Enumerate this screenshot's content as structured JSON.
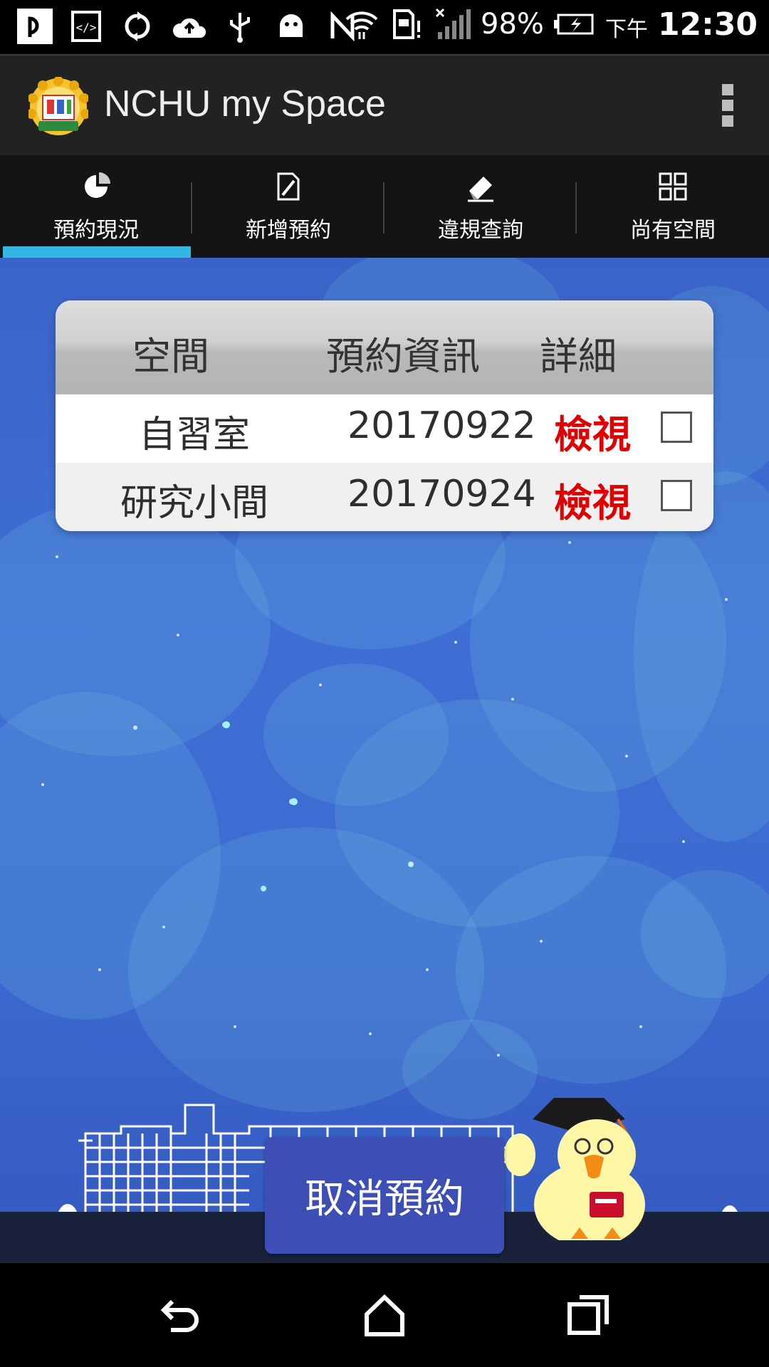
{
  "status_bar": {
    "battery_percent": "98%",
    "time_prefix": "下午",
    "time": "12:30",
    "icons": [
      "app-p-icon",
      "code-icon",
      "sync-icon",
      "cloud-upload-icon",
      "usb-icon",
      "android-icon",
      "nfc-icon",
      "wifi-icon",
      "sim-alert-icon",
      "signal-icon",
      "battery-charging-icon"
    ]
  },
  "app_bar": {
    "title": "NCHU my Space",
    "logo_text": "NCHU Library"
  },
  "tabs": [
    {
      "label": "預約現況",
      "icon": "pie-chart-icon",
      "active": true
    },
    {
      "label": "新增預約",
      "icon": "document-edit-icon",
      "active": false
    },
    {
      "label": "違規查詢",
      "icon": "eraser-icon",
      "active": false
    },
    {
      "label": "尚有空間",
      "icon": "grid-icon",
      "active": false
    }
  ],
  "reservations": {
    "headers": {
      "space": "空間",
      "info": "預約資訊",
      "detail": "詳細"
    },
    "rows": [
      {
        "space": "自習室",
        "date": "20170922",
        "view": "檢視",
        "checked": false
      },
      {
        "space": "研究小間",
        "date": "20170924",
        "view": "檢視",
        "checked": false
      }
    ]
  },
  "cancel_button": {
    "label": "取消預約"
  },
  "colors": {
    "accent": "#33b5e5",
    "view_link": "#e00000",
    "cancel_button": "#3d4fb5",
    "background": "#3d6ad2"
  }
}
